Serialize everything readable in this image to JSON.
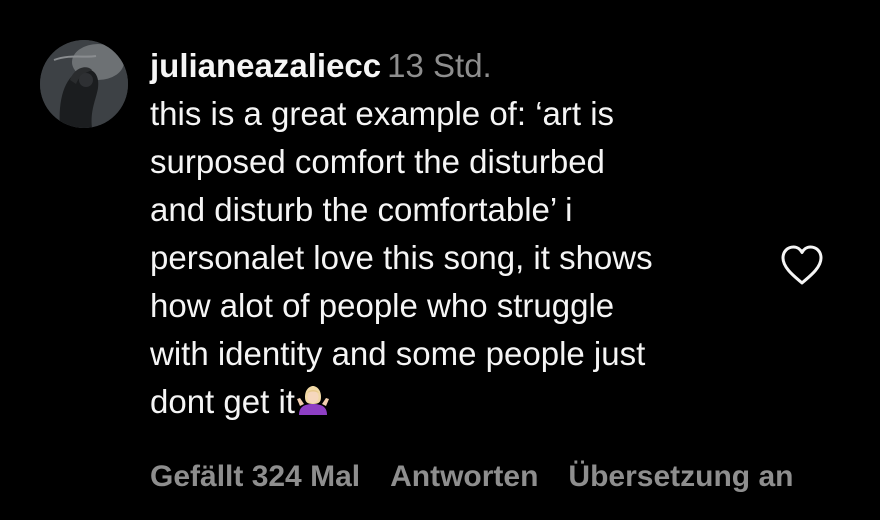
{
  "comment": {
    "username": "julianeazaliecc",
    "timestamp": "13 Std.",
    "lines": [
      "this is a great example of: ‘art is",
      "surposed comfort the disturbed",
      "and disturb the comfortable’ i",
      "personalet love this song, it shows",
      "how alot of people who struggle",
      "with identity and some people just",
      "dont get it"
    ],
    "emoji_icon": "woman-shrugging-emoji-icon",
    "like_icon": "heart-outline-icon"
  },
  "actions": {
    "likes": "Gefällt 324 Mal",
    "reply": "Antworten",
    "translate": "Übersetzung an"
  },
  "colors": {
    "background": "#000000",
    "text": "#f5f5f5",
    "secondary": "#8e8e8e"
  }
}
